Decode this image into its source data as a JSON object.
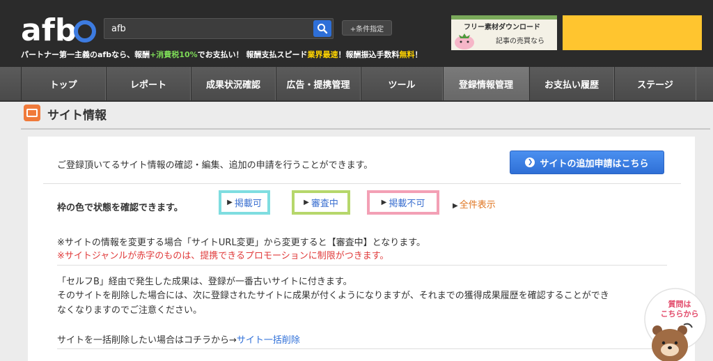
{
  "header": {
    "logo": "afb",
    "tagline_parts": [
      "パートナー第一主義のafbなら、報酬",
      "+消費税10%",
      "でお支払い！ 報酬支払スピード",
      "業界最速",
      "！報酬振込手数料",
      "無料",
      "！"
    ],
    "search_value": "afb",
    "search_placeholder": "",
    "condition_label": "+条件指定",
    "banner_line1": "フリー素材ダウンロード",
    "banner_line2": "記事の売買なら"
  },
  "nav": {
    "items": [
      {
        "label": "トップ",
        "active": false
      },
      {
        "label": "レポート",
        "active": false
      },
      {
        "label": "成果状況確認",
        "active": false
      },
      {
        "label": "広告・提携管理",
        "active": false
      },
      {
        "label": "ツール",
        "active": false
      },
      {
        "label": "登録情報管理",
        "active": true
      },
      {
        "label": "お支払い履歴",
        "active": false
      },
      {
        "label": "ステージ",
        "active": false
      }
    ]
  },
  "page": {
    "title": "サイト情報",
    "intro": "ご登録頂いてるサイト情報の確認・編集、追加の申請を行うことができます。",
    "add_button": "サイトの追加申請はこちら",
    "status_label": "枠の色で状態を確認できます。",
    "legend": {
      "posted": "掲載可",
      "reviewing": "審査中",
      "rejected": "掲載不可",
      "all": "全件表示"
    },
    "note1": "※サイトの情報を変更する場合「サイトURL変更」から変更すると【審査中】となります。",
    "note2": "※サイトジャンルが赤字のものは、提携できるプロモーションに制限がつきます。",
    "self_b_1": "「セルフB」経由で発生した成果は、登録が一番古いサイトに付きます。",
    "self_b_2": "そのサイトを削除した場合には、次に登録されたサイトに成果が付くようになりますが、それまでの獲得成果履歴を確認することができ",
    "self_b_3": "なくなりますのでご注意ください。",
    "bulk_text": "サイトを一括削除したい場合はコチラから→",
    "bulk_link": "サイト一括削除"
  },
  "help": {
    "line1": "質問は",
    "line2": "こちらから"
  },
  "colors": {
    "header_bg": "#2b2b2b",
    "accent_blue": "#2f6fd6",
    "legend_blue": "#7fdde0",
    "legend_green": "#b6d76b",
    "legend_pink": "#f3a0b5",
    "warning_red": "#e03a3a",
    "link_orange": "#e07622"
  }
}
